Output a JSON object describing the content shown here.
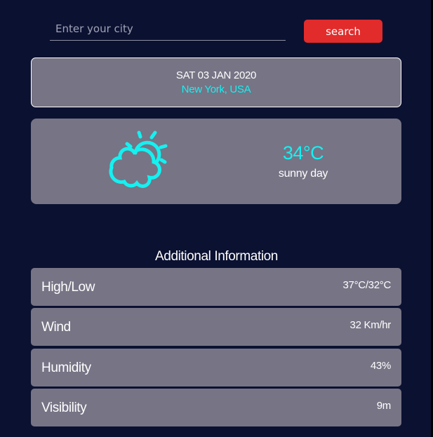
{
  "search": {
    "placeholder": "Enter your city",
    "value": "",
    "button_label": "search"
  },
  "date_card": {
    "date": "SAT 03 JAN 2020",
    "location": "New York, USA"
  },
  "weather": {
    "icon": "partly-cloudy-icon",
    "temperature": "34°C",
    "condition": "sunny day"
  },
  "additional": {
    "heading": "Additional Information",
    "rows": [
      {
        "label": "High/Low",
        "value": "37°C/32°C"
      },
      {
        "label": "Wind",
        "value": "32 Km/hr"
      },
      {
        "label": "Humidity",
        "value": "43%"
      },
      {
        "label": "Visibility",
        "value": "9m"
      }
    ]
  },
  "colors": {
    "background": "#0b1131",
    "card": "#777485",
    "accent": "#14f1f1",
    "button": "#e22b2b"
  }
}
